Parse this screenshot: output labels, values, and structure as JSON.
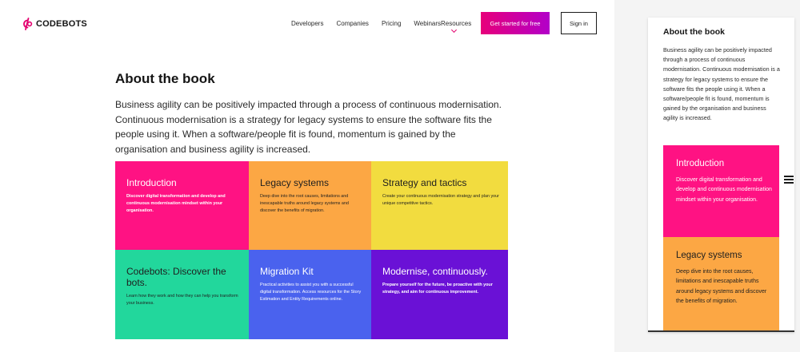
{
  "brand": {
    "name": "CODEBOTS",
    "accent": "#e3006e"
  },
  "nav": {
    "links": [
      "Developers",
      "Companies",
      "Pricing",
      "Webinars"
    ],
    "resources_label": "Resources",
    "cta_label": "Get started for free",
    "signin_label": "Sign in"
  },
  "content": {
    "title": "About the book",
    "intro": "Business agility can be positively impacted through a process of continuous modernisation. Continuous modernisation is a strategy for legacy systems to ensure the software fits the people using it. When a software/people fit is found, momentum is gained by the organisation and business agility is increased."
  },
  "tiles": [
    {
      "title": "Introduction",
      "text": "Discover digital transformation and develop and continuous modernisation mindset within your organisation.",
      "color": "#ff1283",
      "tone": "light",
      "bold": true
    },
    {
      "title": "Legacy systems",
      "text": "Deep dive into the root causes, limitations and inescapable truths around legacy systems and discover the benefits of migration.",
      "color": "#fca744",
      "tone": "dark",
      "bold": false
    },
    {
      "title": "Strategy and tactics",
      "text": "Create your continuous modernisation strategy and plan your unique competitive tactics.",
      "color": "#f2dc3f",
      "tone": "dark",
      "bold": false
    },
    {
      "title": "Codebots: Discover the bots.",
      "text": "Learn how they work and how they can help you transform your business.",
      "color": "#22d79c",
      "tone": "dark",
      "bold": false
    },
    {
      "title": "Migration Kit",
      "text": "Practical activities to assist you with a successful digital transformation. Access resources for the Story Estimation and Entity Requirements online.",
      "color": "#4a62ee",
      "tone": "light",
      "bold": false
    },
    {
      "title": "Modernise, continuously.",
      "text": "Prepare yourself for the future, be proactive with your strategy, and aim for continuous improvement.",
      "color": "#6a11d6",
      "tone": "light",
      "bold": true
    }
  ],
  "mobile": {
    "title": "About the book",
    "text": "Business agility can be positively impacted through a process of continuous modernisation. Continuous modernisation is a strategy for legacy systems to ensure the software fits the people using it. When a software/people fit is found, momentum is gained by the organisation and business agility is increased.",
    "menu_icon": "hamburger-menu-icon"
  }
}
